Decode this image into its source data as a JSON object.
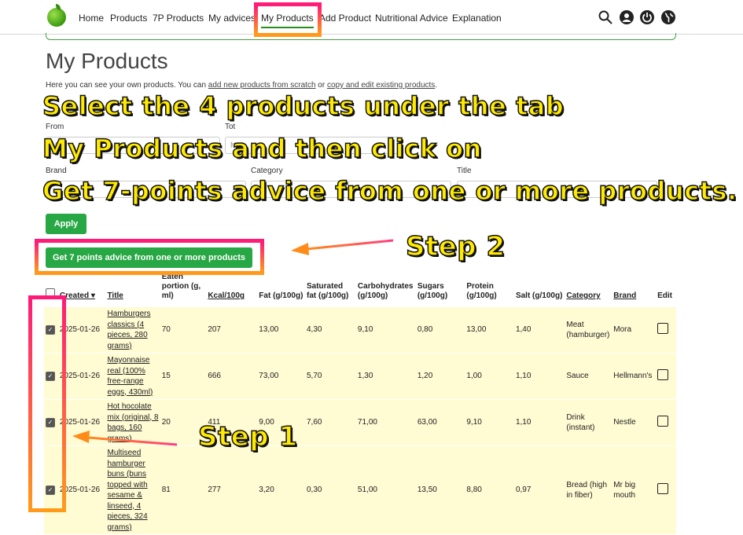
{
  "nav": {
    "items": [
      "Home",
      "Products",
      "7P Products",
      "My advices",
      "My Products",
      "Add Product",
      "Nutritional Advice",
      "Explanation"
    ],
    "active": "My Products"
  },
  "icons": [
    "search-icon",
    "user-icon",
    "power-icon",
    "globe-icon"
  ],
  "page": {
    "title": "My Products",
    "intro_prefix": "Here you can see your own products. You can ",
    "intro_link1": "add new products from scratch",
    "intro_mid": " or ",
    "intro_link2": "copy and edit existing products",
    "intro_suffix": "."
  },
  "filters": {
    "from_label": "From",
    "from_placeholder": "MM",
    "tot_label": "Tot",
    "tot_placeholder": "MM",
    "brand_label": "Brand",
    "category_label": "Category",
    "title_label": "Title",
    "apply_label": "Apply"
  },
  "advice_button": "Get 7 points advice from one or more products",
  "overlay": {
    "line1": "Select the 4 products under the tab",
    "line2": "My Products and then click on",
    "line3": "Get 7-points advice from one or more products.",
    "step1": "Step 1",
    "step2": "Step 2"
  },
  "table": {
    "headers": [
      "Created",
      "Title",
      "Eaten portion (g, ml)",
      "Kcal/100g",
      "Fat (g/100g)",
      "Saturated fat (g/100g)",
      "Carbohydrates (g/100g)",
      "Sugars (g/100g)",
      "Protein (g/100g)",
      "Salt (g/100g)",
      "Category",
      "Brand",
      "Edit"
    ],
    "rows": [
      {
        "created": "2025-01-26",
        "title": "Hamburgers classics (4 pieces, 280 grams)",
        "portion": "70",
        "kcal": "207",
        "fat": "13,00",
        "satfat": "4,30",
        "carbs": "9,10",
        "sugars": "0,80",
        "protein": "13,00",
        "salt": "1,40",
        "category": "Meat (hamburger)",
        "brand": "Mora"
      },
      {
        "created": "2025-01-26",
        "title": "Mayonnaise real (100% free-range eggs, 430ml)",
        "portion": "15",
        "kcal": "666",
        "fat": "73,00",
        "satfat": "5,70",
        "carbs": "1,30",
        "sugars": "1,20",
        "protein": "1,00",
        "salt": "1,10",
        "category": "Sauce",
        "brand": "Hellmann's"
      },
      {
        "created": "2025-01-26",
        "title": "Hot hocolate mix (original, 8 bags, 160 grams)",
        "portion": "20",
        "kcal": "411",
        "fat": "9,00",
        "satfat": "7,60",
        "carbs": "71,00",
        "sugars": "63,00",
        "protein": "9,10",
        "salt": "1,10",
        "category": "Drink (instant)",
        "brand": "Nestle"
      },
      {
        "created": "2025-01-26",
        "title": "Multiseed hamburger buns (buns topped with sesame & linseed, 4 pieces, 324 grams)",
        "portion": "81",
        "kcal": "277",
        "fat": "3,20",
        "satfat": "0,30",
        "carbs": "51,00",
        "sugars": "13,50",
        "protein": "8,80",
        "salt": "0,97",
        "category": "Bread (high in fiber)",
        "brand": "Mr big mouth"
      }
    ]
  }
}
